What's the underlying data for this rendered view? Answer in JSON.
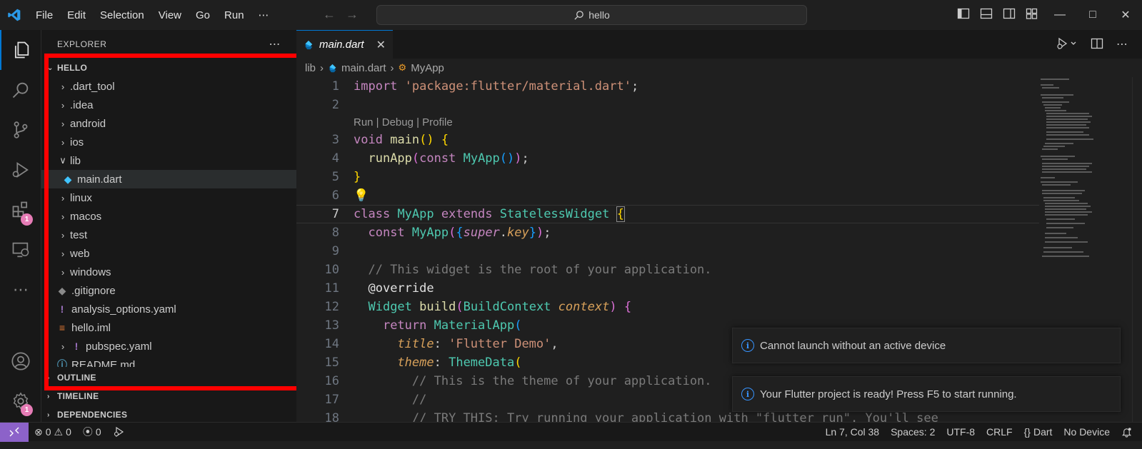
{
  "menu": [
    "File",
    "Edit",
    "Selection",
    "View",
    "Go",
    "Run",
    "⋯"
  ],
  "search": {
    "text": "hello"
  },
  "explorer": {
    "header": "EXPLORER",
    "more": "⋯",
    "root": "HELLO",
    "items": [
      {
        "label": ".dart_tool",
        "type": "folder",
        "chev": "›"
      },
      {
        "label": ".idea",
        "type": "folder",
        "chev": "›"
      },
      {
        "label": "android",
        "type": "folder",
        "chev": "›"
      },
      {
        "label": "ios",
        "type": "folder",
        "chev": "›"
      },
      {
        "label": "lib",
        "type": "folder-open",
        "chev": "⌄"
      },
      {
        "label": "main.dart",
        "type": "dart"
      },
      {
        "label": "linux",
        "type": "folder",
        "chev": "›"
      },
      {
        "label": "macos",
        "type": "folder",
        "chev": "›"
      },
      {
        "label": "test",
        "type": "folder",
        "chev": "›"
      },
      {
        "label": "web",
        "type": "folder",
        "chev": "›"
      },
      {
        "label": "windows",
        "type": "folder",
        "chev": "›"
      },
      {
        "label": ".gitignore",
        "type": "git"
      },
      {
        "label": "analysis_options.yaml",
        "type": "yaml"
      },
      {
        "label": "hello.iml",
        "type": "iml"
      },
      {
        "label": "pubspec.yaml",
        "type": "yaml2",
        "chev": "›"
      },
      {
        "label": "README.md",
        "type": "md"
      }
    ],
    "sections": [
      "OUTLINE",
      "TIMELINE",
      "DEPENDENCIES"
    ]
  },
  "tab": {
    "label": "main.dart",
    "close": "✕"
  },
  "breadcrumbs": {
    "folder": "lib",
    "file": "main.dart",
    "symbol": "MyApp"
  },
  "codelens": "Run | Debug | Profile",
  "line_numbers": [
    "1",
    "2",
    "3",
    "4",
    "5",
    "6",
    "7",
    "8",
    "9",
    "10",
    "11",
    "12",
    "13",
    "14",
    "15",
    "16",
    "17",
    "18"
  ],
  "notifications": [
    "Cannot launch without an active device",
    "Your Flutter project is ready! Press F5 to start running."
  ],
  "status": {
    "errors": "0",
    "warnings": "0",
    "ports": "0",
    "position": "Ln 7, Col 38",
    "spaces": "Spaces: 2",
    "encoding": "UTF-8",
    "eol": "CRLF",
    "language": "Dart",
    "language_icon": "{}",
    "device": "No Device"
  },
  "badges": {
    "extensions": "1",
    "settings": "1"
  },
  "colors": {
    "accent": "#0078d4",
    "remote": "#8c62c9",
    "highlight": "#ff0000",
    "badge": "#e67cb6"
  }
}
